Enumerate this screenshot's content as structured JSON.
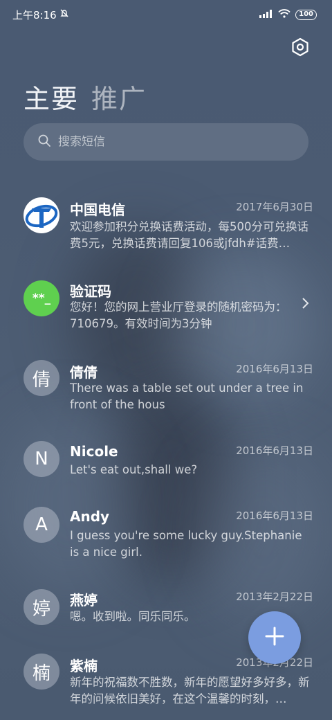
{
  "status_bar": {
    "time": "上午8:16",
    "battery": "100"
  },
  "header": {
    "tabs": [
      {
        "label": "主要",
        "active": true
      },
      {
        "label": "推广",
        "active": false
      }
    ]
  },
  "search": {
    "placeholder": "搜索短信"
  },
  "conversations": [
    {
      "name": "中国电信",
      "date": "2017年6月30日",
      "preview": "欢迎参加积分兑换话费活动，每500分可兑换话费5元，兑换话费请回复106或jfdh#话费…",
      "avatar": "china-telecom-logo"
    },
    {
      "name": "验证码",
      "date": "",
      "preview": "您好！您的网上营业厅登录的随机密码为：710679。有效时间为3分钟",
      "avatar_text": "**_"
    },
    {
      "name": "倩倩",
      "date": "2016年6月13日",
      "preview": "There was a table set out under a tree in front of the hous",
      "avatar_text": "倩"
    },
    {
      "name": "Nicole",
      "date": "2016年6月13日",
      "preview": "Let's eat out,shall we?",
      "avatar_text": "N"
    },
    {
      "name": "Andy",
      "date": "2016年6月13日",
      "preview": "I guess you're some lucky guy.Stephanie is a nice girl.",
      "avatar_text": "A"
    },
    {
      "name": "燕婷",
      "date": "2013年2月22日",
      "preview": "嗯。收到啦。同乐同乐。",
      "avatar_text": "婷"
    },
    {
      "name": "紫楠",
      "date": "2013年2月22日",
      "preview": "新年的祝福数不胜数，新年的愿望好多好多，新年的问候依旧美好，在这个温馨的时刻，…",
      "avatar_text": "楠"
    }
  ],
  "colors": {
    "accent_fab": "#7b9de0",
    "verify_avatar": "#5fd04f",
    "telecom_blue": "#1c66c2"
  },
  "icons": {
    "settings": "hexagon-gear-icon",
    "search": "search-icon",
    "fab": "plus-icon",
    "chevron": "chevron-right-icon"
  }
}
